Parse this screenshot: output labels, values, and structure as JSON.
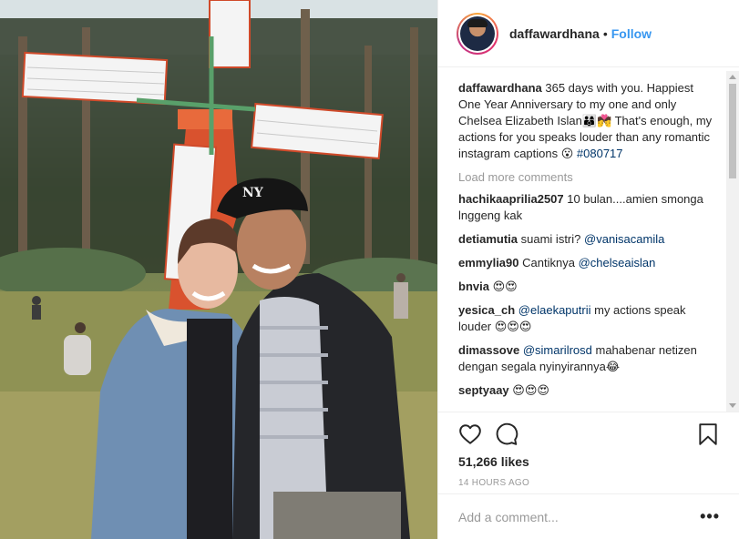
{
  "post": {
    "username": "daffawardhana",
    "separator": "•",
    "follow_label": "Follow"
  },
  "caption": {
    "username": "daffawardhana",
    "text": "365 days with you. Happiest One Year Anniversary to my one and only Chelsea Elizabeth Islan👨‍👩‍👦💏 That's enough, my actions for you speaks louder than any romantic instagram captions 😮",
    "hashtag": "#080717"
  },
  "load_more_label": "Load more comments",
  "comments": [
    {
      "username": "hachikaaprilia2507",
      "text": "10 bulan....amien smonga lnggeng kak",
      "mention": ""
    },
    {
      "username": "detiamutia",
      "text": "suami istri?",
      "mention": "@vanisacamila"
    },
    {
      "username": "emmylia90",
      "text": "Cantiknya",
      "mention": "@chelseaislan"
    },
    {
      "username": "bnvia",
      "text": "😍😍",
      "mention": ""
    },
    {
      "username": "yesica_ch",
      "text": "my actions speak louder 😍😍😍",
      "mention": "@elaekaputrii"
    },
    {
      "username": "dimassove",
      "text": "mahabenar netizen dengan segala nyinyirannya😂",
      "mention": "@simarilrosd"
    },
    {
      "username": "septyaay",
      "text": "😍😍😍",
      "mention": ""
    }
  ],
  "likes_label": "51,266 likes",
  "time_ago": "14 HOURS AGO",
  "add_comment_placeholder": "Add a comment...",
  "more_label": "•••",
  "icons": {
    "like": "heart-icon",
    "comment": "speech-bubble-icon",
    "save": "bookmark-icon",
    "more": "more-options-icon"
  },
  "colors": {
    "link_blue": "#3897f0",
    "tag_blue": "#003569",
    "muted_gray": "#999999",
    "text": "#262626"
  }
}
